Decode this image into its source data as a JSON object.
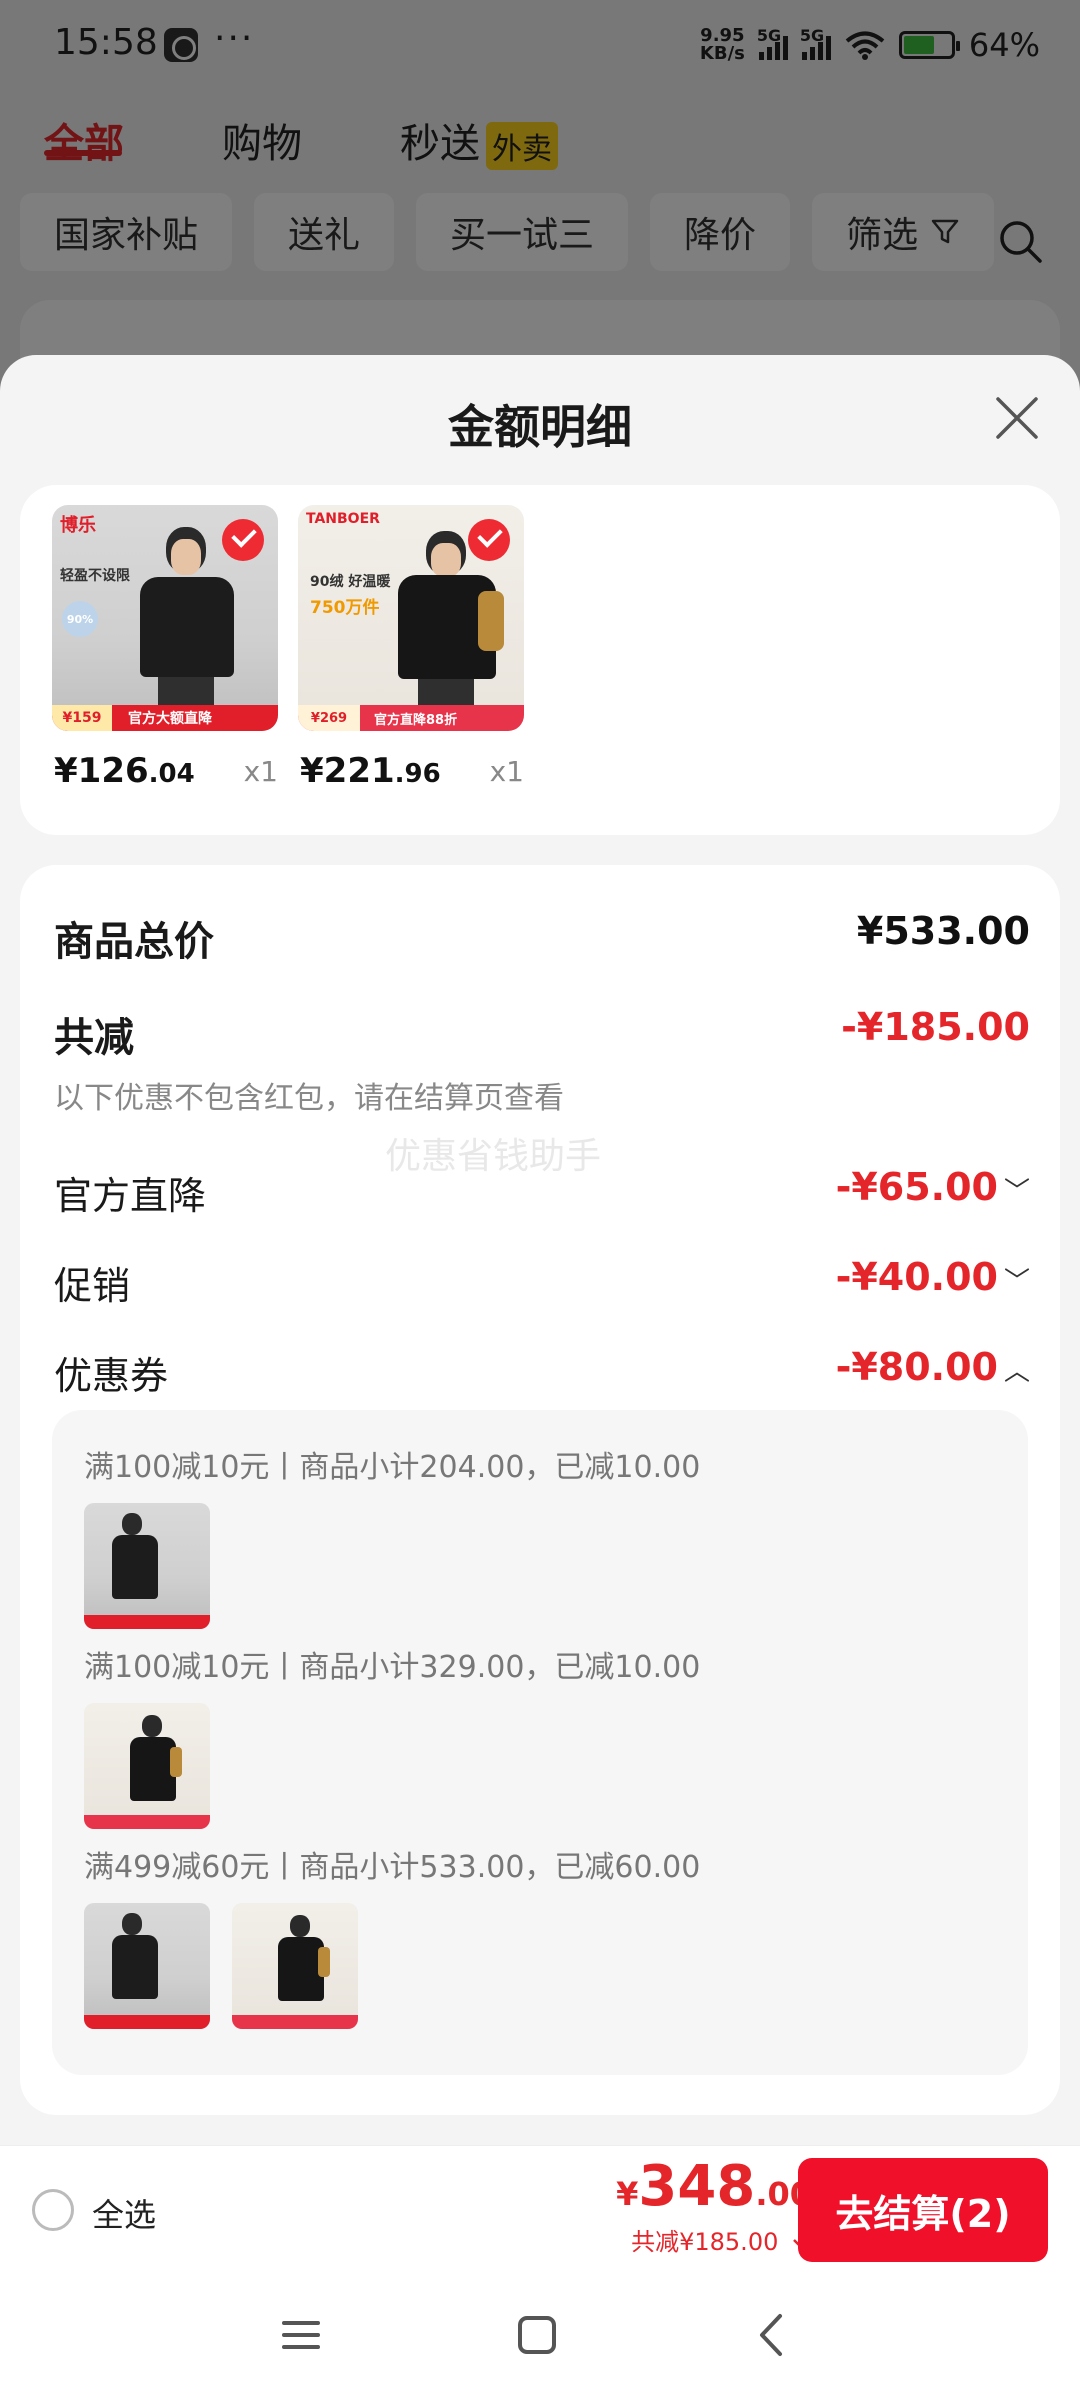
{
  "status": {
    "time": "15:58",
    "more": "···",
    "net_speed_value": "9.95",
    "net_speed_unit": "KB/s",
    "sim1": "5G",
    "sim2": "5G",
    "battery": "64%"
  },
  "tabs": [
    {
      "label": "全部",
      "active": true
    },
    {
      "label": "购物",
      "active": false
    },
    {
      "label": "秒送",
      "badge": "外卖",
      "active": false
    }
  ],
  "filters": [
    "国家补贴",
    "送礼",
    "买一试三",
    "降价",
    "筛选"
  ],
  "sheet": {
    "title": "金额明细"
  },
  "products": [
    {
      "price_int": "¥126",
      "price_dec": ".04",
      "qty": "x1",
      "brand": "博乐",
      "tagline": "轻盈不设限",
      "badge": "90%",
      "strip_price": "¥159",
      "strip_text": "官方大额直降"
    },
    {
      "price_int": "¥221",
      "price_dec": ".96",
      "qty": "x1",
      "brand": "TANBOER",
      "tagline": "90绒 好温暖",
      "highlight": "750万件",
      "strip_price": "¥269",
      "strip_text": "官方直降88折"
    }
  ],
  "summary": {
    "total_label": "商品总价",
    "total_value": "¥533.00",
    "discount_label": "共减",
    "discount_value": "-¥185.00",
    "note": "以下优惠不包含红包，请在结算页查看",
    "watermark": "优惠省钱助手",
    "rows": [
      {
        "label": "官方直降",
        "value": "-¥65.00",
        "chevron": "﹀"
      },
      {
        "label": "促销",
        "value": "-¥40.00",
        "chevron": "﹀"
      },
      {
        "label": "优惠券",
        "value": "-¥80.00",
        "chevron": "︿"
      }
    ]
  },
  "coupons": [
    {
      "text": "满100减10元丨商品小计204.00，已减10.00"
    },
    {
      "text": "满100减10元丨商品小计329.00，已减10.00"
    },
    {
      "text": "满499减60元丨商品小计533.00，已减60.00"
    }
  ],
  "bottom": {
    "select_all": "全选",
    "currency": "¥",
    "total_int": "348",
    "total_dec": ".00",
    "discount": "共减¥185.00",
    "checkout": "去结算(2)"
  },
  "colors": {
    "accent_red": "#e4262b",
    "checkout_red": "#f0102a",
    "waimai_yellow": "#ffd21f"
  },
  "icons": [
    "search-icon",
    "close-icon",
    "filter-icon",
    "check-icon",
    "menu-icon",
    "home-icon",
    "back-icon"
  ]
}
